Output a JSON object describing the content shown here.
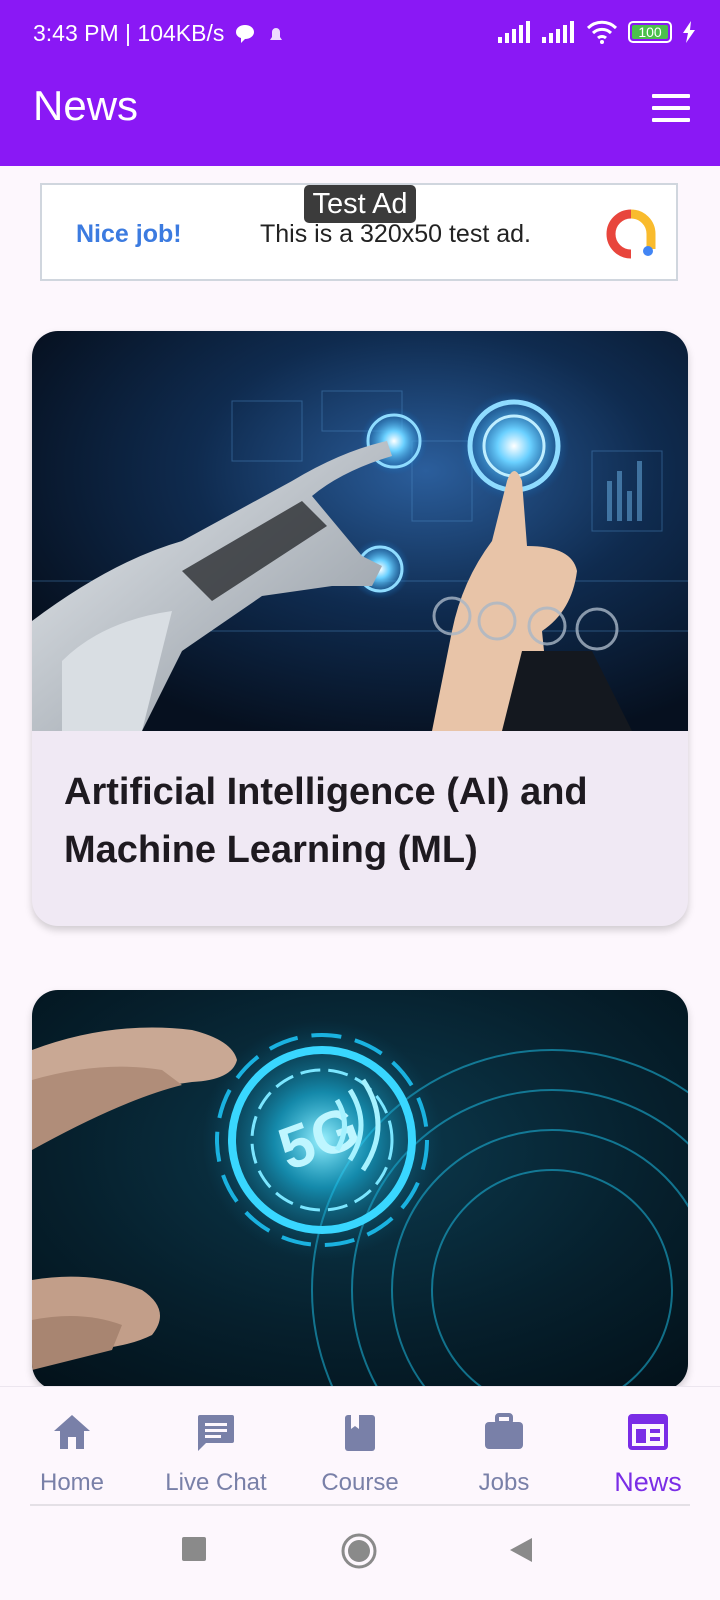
{
  "status_bar": {
    "time_speed": "3:43 PM | 104KB/s",
    "battery": "100"
  },
  "app_bar": {
    "title": "News"
  },
  "ad": {
    "badge": "Test Ad",
    "left_text": "Nice job!",
    "message": "This is a 320x50 test ad."
  },
  "cards": [
    {
      "title": "Artificial Intelligence (AI) and Machine Learning (ML)"
    },
    {
      "title": ""
    }
  ],
  "bottom_nav": {
    "items": [
      {
        "label": "Home",
        "icon": "home-icon"
      },
      {
        "label": "Live Chat",
        "icon": "chat-icon"
      },
      {
        "label": "Course",
        "icon": "book-icon"
      },
      {
        "label": "Jobs",
        "icon": "briefcase-icon"
      },
      {
        "label": "News",
        "icon": "news-icon"
      }
    ],
    "active": "News"
  },
  "colors": {
    "primary": "#8a18f5",
    "nav_inactive": "#7980a8",
    "nav_active": "#7a2de6",
    "card_bg": "#f0e9f4"
  }
}
